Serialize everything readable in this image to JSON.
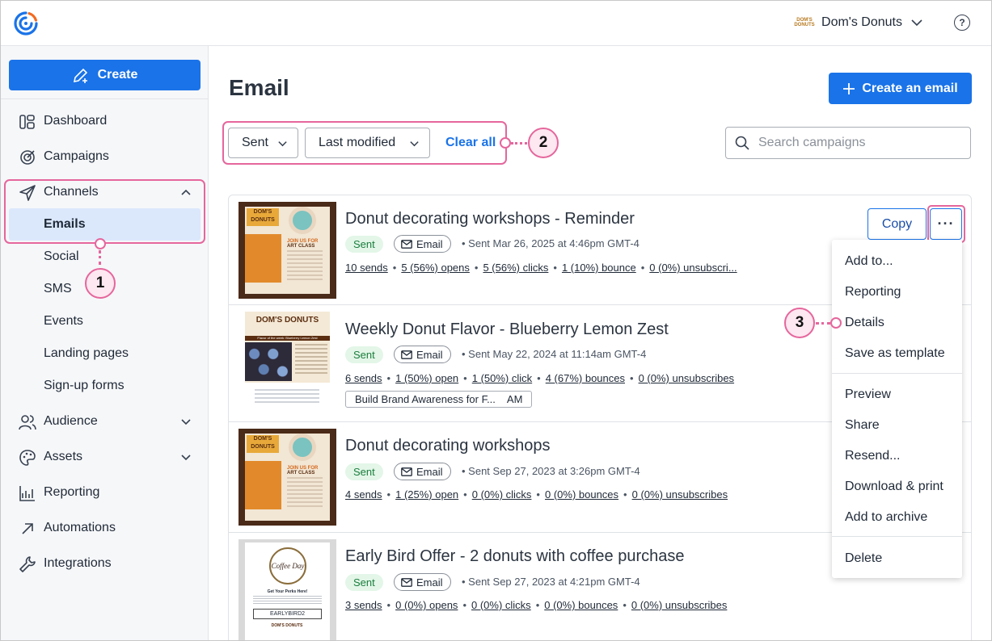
{
  "account": {
    "name": "Dom's Donuts",
    "logo_text": "DOM'S DONUTS"
  },
  "help_label": "?",
  "sidebar": {
    "create_label": "Create",
    "items": [
      {
        "label": "Dashboard",
        "icon": "dashboard-icon"
      },
      {
        "label": "Campaigns",
        "icon": "campaigns-icon"
      },
      {
        "label": "Channels",
        "icon": "send-icon"
      },
      {
        "label": "Audience",
        "icon": "people-icon"
      },
      {
        "label": "Assets",
        "icon": "palette-icon"
      },
      {
        "label": "Reporting",
        "icon": "chart-icon"
      },
      {
        "label": "Automations",
        "icon": "arrow-up-right-icon"
      },
      {
        "label": "Integrations",
        "icon": "wrench-icon"
      }
    ],
    "channels_sub": [
      "Emails",
      "Social",
      "SMS",
      "Events",
      "Landing pages",
      "Sign-up forms"
    ]
  },
  "main": {
    "title": "Email",
    "create_email_label": "Create an email",
    "filters": {
      "status": "Sent",
      "sort": "Last modified",
      "clear_label": "Clear all"
    },
    "search_placeholder": "Search campaigns"
  },
  "campaigns": [
    {
      "title": "Donut decorating workshops - Reminder",
      "status": "Sent",
      "channel": "Email",
      "sent_info": "Sent Mar 26, 2025 at 4:46pm GMT-4",
      "stats": [
        "10 sends",
        "5 (56%) opens",
        "5 (56%) clicks",
        "1 (10%) bounce",
        "0 (0%) unsubscri..."
      ]
    },
    {
      "title": "Weekly Donut Flavor - Blueberry Lemon Zest",
      "status": "Sent",
      "channel": "Email",
      "sent_info": "Sent May 22, 2024 at 11:14am GMT-4",
      "stats": [
        "6 sends",
        "1 (50%) open",
        "1 (50%) click",
        "4 (67%) bounces",
        "0 (0%) unsubscribes"
      ],
      "campaign_tag": {
        "name": "Build Brand Awareness for F...",
        "suffix": "AM"
      }
    },
    {
      "title": "Donut decorating workshops",
      "status": "Sent",
      "channel": "Email",
      "sent_info": "Sent Sep 27, 2023 at 3:26pm GMT-4",
      "stats": [
        "4 sends",
        "1 (25%) open",
        "0 (0%) clicks",
        "0 (0%) bounces",
        "0 (0%) unsubscribes"
      ]
    },
    {
      "title": "Early Bird Offer - 2 donuts with coffee purchase",
      "status": "Sent",
      "channel": "Email",
      "sent_info": "Sent Sep 27, 2023 at 4:21pm GMT-4",
      "stats": [
        "3 sends",
        "0 (0%) opens",
        "0 (0%) clicks",
        "0 (0%) bounces",
        "0 (0%) unsubscribes"
      ]
    }
  ],
  "thumbs": {
    "workshop": {
      "logo": "DOM'S DONUTS",
      "head": "JOIN US FOR",
      "sub": "ART CLASS"
    },
    "flavor": {
      "logo": "DOM'S DONUTS",
      "tagline": "Flavor of the week: Blueberry Lemon Zest"
    },
    "coffee": {
      "logo": "Coffee Day",
      "head": "Get Your Perks Here!",
      "code": "EARLYBIRD2"
    }
  },
  "row_actions": {
    "copy_label": "Copy",
    "more_label": "···"
  },
  "menu": {
    "group1": [
      "Add to...",
      "Reporting",
      "Details",
      "Save as template"
    ],
    "group2": [
      "Preview",
      "Share",
      "Resend...",
      "Download & print",
      "Add to archive"
    ],
    "group3": [
      "Delete"
    ]
  },
  "callouts": [
    "1",
    "2",
    "3"
  ],
  "colors": {
    "primary": "#1a73e8",
    "highlight": "#e5669c",
    "sent_tag": "#e3f6e8"
  }
}
